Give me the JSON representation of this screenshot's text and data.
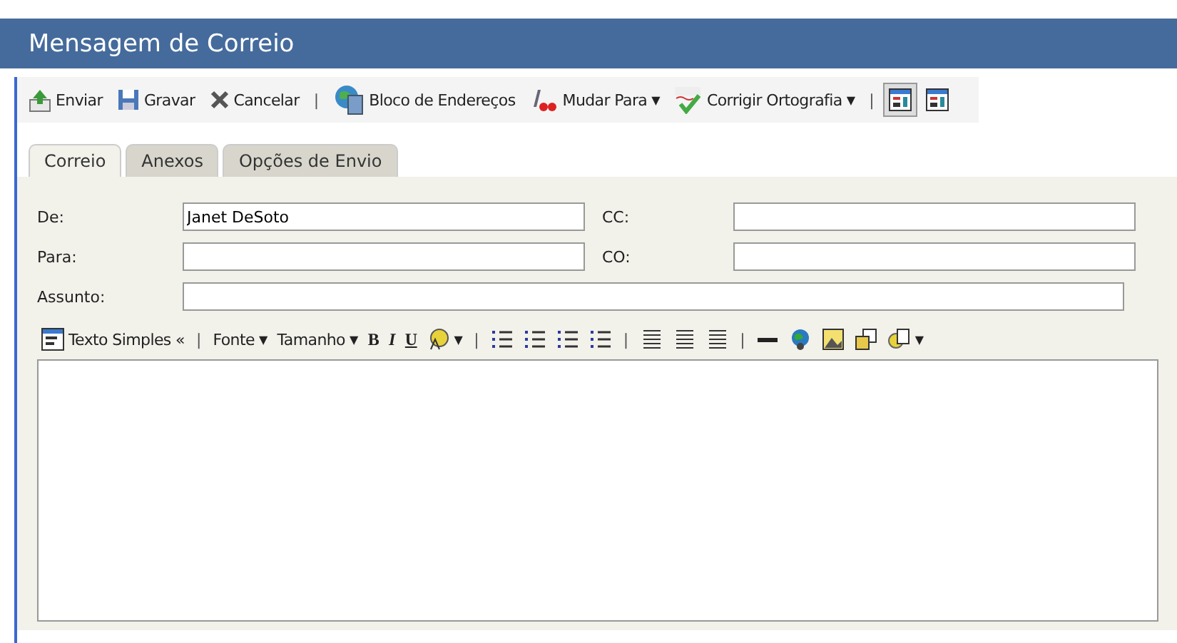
{
  "window": {
    "title": "Mensagem de Correio"
  },
  "toolbar": [
    {
      "kind": "button",
      "label": "Enviar"
    },
    {
      "kind": "button",
      "label": "Gravar"
    },
    {
      "kind": "button",
      "label": "Cancelar"
    },
    {
      "kind": "separator",
      "label": "|"
    },
    {
      "kind": "button",
      "label": "Bloco de Endereços"
    },
    {
      "kind": "button",
      "label": "Mudar Para",
      "caret": "▼"
    },
    {
      "kind": "button",
      "label": "Corrigir Ortografia",
      "caret": "▼"
    },
    {
      "kind": "separator",
      "label": "|"
    },
    {
      "kind": "view",
      "selected": true
    },
    {
      "kind": "view",
      "selected": false
    }
  ],
  "tabs": [
    {
      "label": "Correio",
      "selected": true
    },
    {
      "label": "Anexos",
      "selected": false
    },
    {
      "label": "Opções de Envio",
      "selected": false
    }
  ],
  "fields": [
    {
      "label": "De:",
      "value": "Janet DeSoto",
      "label2": "CC:"
    },
    {
      "label": "Para:",
      "label2": "CO:"
    },
    {
      "label": "Assunto:"
    }
  ],
  "editor_toolbar": [
    {
      "kind": "button",
      "label": "Texto Simples «"
    },
    {
      "kind": "separator",
      "label": "|"
    },
    {
      "kind": "text",
      "label": "Fonte",
      "caret": "▼"
    },
    {
      "kind": "text",
      "label": "Tamanho",
      "caret": "▼"
    },
    {
      "kind": "glyph",
      "label": "B"
    },
    {
      "kind": "glyph",
      "label": "I"
    },
    {
      "kind": "glyph",
      "label": "U"
    },
    {
      "kind": "icon",
      "caret": "▼"
    },
    {
      "kind": "separator",
      "label": "|"
    },
    {
      "kind": "icon"
    },
    {
      "kind": "icon"
    },
    {
      "kind": "icon"
    },
    {
      "kind": "icon"
    },
    {
      "kind": "separator",
      "label": "|"
    },
    {
      "kind": "icon"
    },
    {
      "kind": "icon"
    },
    {
      "kind": "icon"
    },
    {
      "kind": "separator",
      "label": "|"
    },
    {
      "kind": "icon"
    },
    {
      "kind": "icon"
    },
    {
      "kind": "icon"
    },
    {
      "kind": "icon"
    },
    {
      "kind": "icon",
      "caret": "▼"
    }
  ]
}
